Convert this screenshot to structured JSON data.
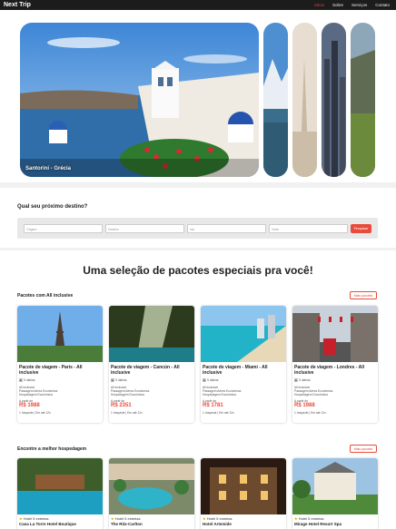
{
  "nav": {
    "brand": "Next Trip",
    "items": [
      {
        "label": "Início",
        "active": true
      },
      {
        "label": "Sobre",
        "active": false
      },
      {
        "label": "Serviços",
        "active": false
      },
      {
        "label": "Contato",
        "active": false
      }
    ]
  },
  "hero": {
    "caption": "Santorini - Grécia"
  },
  "search": {
    "title": "Qual seu próximo destino?",
    "origin_placeholder": "Origem",
    "destination_placeholder": "Destino",
    "departure_placeholder": "Ida",
    "return_placeholder": "Volta",
    "button": "Pesquisar"
  },
  "packages": {
    "headline": "Uma seleção de pacotes especiais pra você!",
    "section_title": "Pacotes com All inclusive",
    "more_button": "Mais pacotes",
    "cards": [
      {
        "title": "Pacote de viagem - Paris - All inclusive",
        "days": "5 diárias",
        "line1": "All inclusive",
        "line2": "Passagem Aérea Econômica",
        "line3": "Hospedagem Econômica",
        "from": "A partir de",
        "price": "R$ 1988",
        "note": "1 hóspede | Em até 12x"
      },
      {
        "title": "Pacote de viagem - Cancún - All inclusive",
        "days": "5 diárias",
        "line1": "All inclusive",
        "line2": "Passagem Aérea Econômica",
        "line3": "Hospedagem Econômica",
        "from": "A partir de",
        "price": "R$ 2351",
        "note": "1 hóspede | Em até 12x"
      },
      {
        "title": "Pacote de viagem - Miami - All inclusive",
        "days": "5 diárias",
        "line1": "All inclusive",
        "line2": "Passagem Aérea Econômica",
        "line3": "Hospedagem Econômica",
        "from": "A partir de",
        "price": "R$ 1781",
        "note": "1 hóspede | Em até 12x"
      },
      {
        "title": "Pacote de viagem - Londres - All inclusive",
        "days": "5 diárias",
        "line1": "All inclusive",
        "line2": "Passagem Aérea Econômica",
        "line3": "Hospedagem Econômica",
        "from": "A partir de",
        "price": "R$ 1988",
        "note": "1 hóspede | Em até 12x"
      }
    ]
  },
  "hotels": {
    "section_title": "Encontre a melhor hospedagem",
    "more_button": "Mais pacotes",
    "cards": [
      {
        "stars": "Hotel 5 estrelas",
        "name": "Casa La Torre Hotel Boutique"
      },
      {
        "stars": "Hotel 5 estrelas",
        "name": "The Ritz-Carlton"
      },
      {
        "stars": "Hotel 5 estrelas",
        "name": "Hotel Artemide"
      },
      {
        "stars": "Hotel 5 estrelas",
        "name": "Mirage Hotel Resort Spa"
      }
    ]
  },
  "colors": {
    "accent": "#e84b3c",
    "nav_bg": "#1c1c1c"
  }
}
